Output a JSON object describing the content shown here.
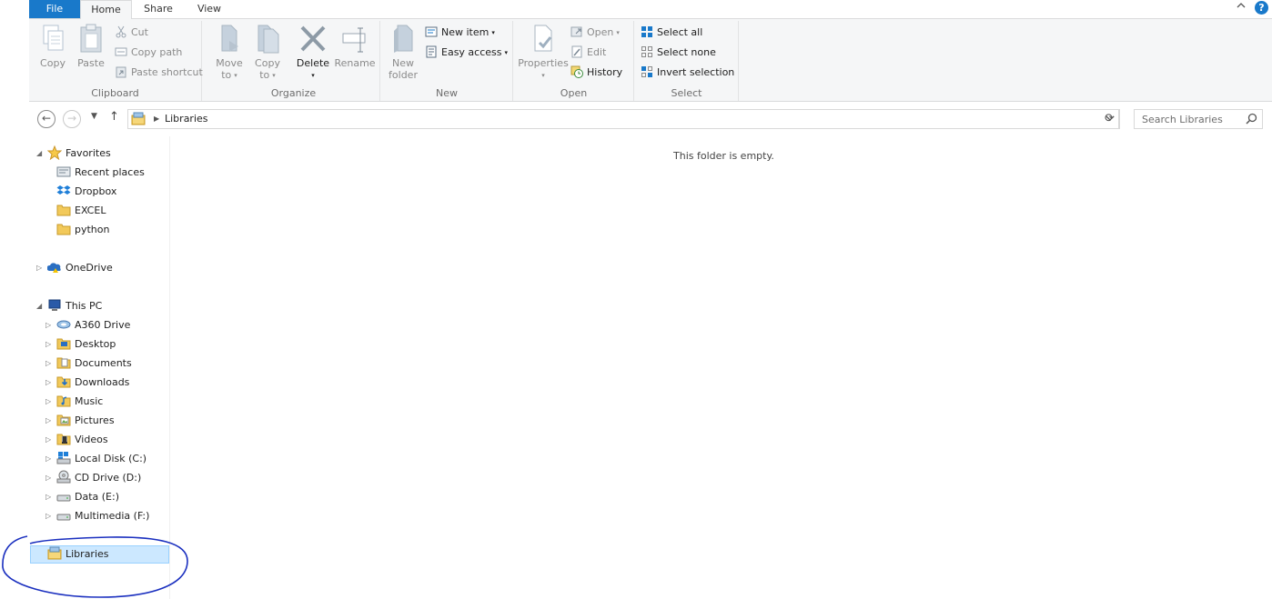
{
  "tabs": {
    "file": "File",
    "home": "Home",
    "share": "Share",
    "view": "View"
  },
  "window": {
    "collapse_icon": "chevron-up-icon",
    "help_glyph": "?"
  },
  "ribbon": {
    "clipboard": {
      "label": "Clipboard",
      "copy": "Copy",
      "paste": "Paste",
      "cut": "Cut",
      "copy_path": "Copy path",
      "paste_shortcut": "Paste shortcut"
    },
    "organize": {
      "label": "Organize",
      "move_to_1": "Move",
      "move_to_2": "to",
      "copy_to_1": "Copy",
      "copy_to_2": "to",
      "delete": "Delete",
      "rename": "Rename"
    },
    "new": {
      "label": "New",
      "new_folder_1": "New",
      "new_folder_2": "folder",
      "new_item": "New item",
      "easy_access": "Easy access"
    },
    "open": {
      "label": "Open",
      "properties": "Properties",
      "open": "Open",
      "edit": "Edit",
      "history": "History"
    },
    "select": {
      "label": "Select",
      "select_all": "Select all",
      "select_none": "Select none",
      "invert_selection": "Invert selection"
    }
  },
  "address": {
    "crumb": "Libraries"
  },
  "search": {
    "placeholder": "Search Libraries"
  },
  "navpane": {
    "favorites": "Favorites",
    "recent_places": "Recent places",
    "dropbox": "Dropbox",
    "excel": "EXCEL",
    "python": "python",
    "onedrive": "OneDrive",
    "this_pc": "This PC",
    "a360": "A360 Drive",
    "desktop": "Desktop",
    "documents": "Documents",
    "downloads": "Downloads",
    "music": "Music",
    "pictures": "Pictures",
    "videos": "Videos",
    "local_disk": "Local Disk (C:)",
    "cd_drive": "CD Drive (D:)",
    "data": "Data (E:)",
    "multimedia": "Multimedia (F:)",
    "libraries": "Libraries"
  },
  "content": {
    "empty_message": "This folder is empty."
  },
  "colors": {
    "accent": "#1979ca",
    "selection": "#cce8ff",
    "annotation": "#1a2fbf"
  }
}
